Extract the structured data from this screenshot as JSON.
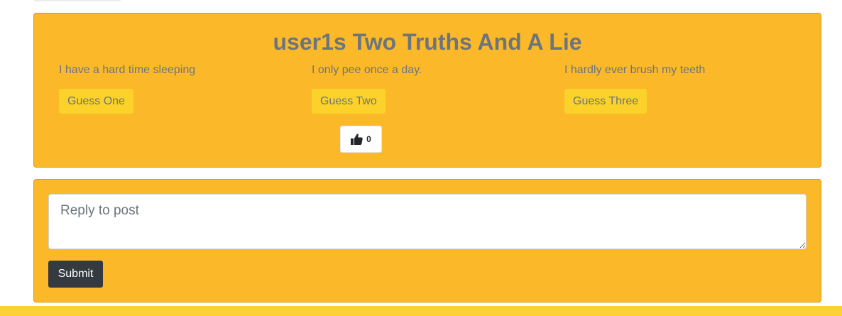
{
  "post": {
    "title": "user1s Two Truths And A Lie",
    "statements": [
      "I have a hard time sleeping",
      "I only pee once a day.",
      "I hardly ever brush my teeth"
    ],
    "guess_buttons": [
      "Guess One",
      "Guess Two",
      "Guess Three"
    ],
    "like": {
      "icon": "thumbs-up-icon",
      "count": "0"
    }
  },
  "reply": {
    "placeholder": "Reply to post",
    "value": "",
    "submit_label": "Submit"
  },
  "colors": {
    "card_bg": "#fbb829",
    "guess_button_bg": "#fcd12a",
    "muted_text": "#6c757d",
    "submit_bg": "#343a40",
    "footer_bar": "#fdd134"
  }
}
